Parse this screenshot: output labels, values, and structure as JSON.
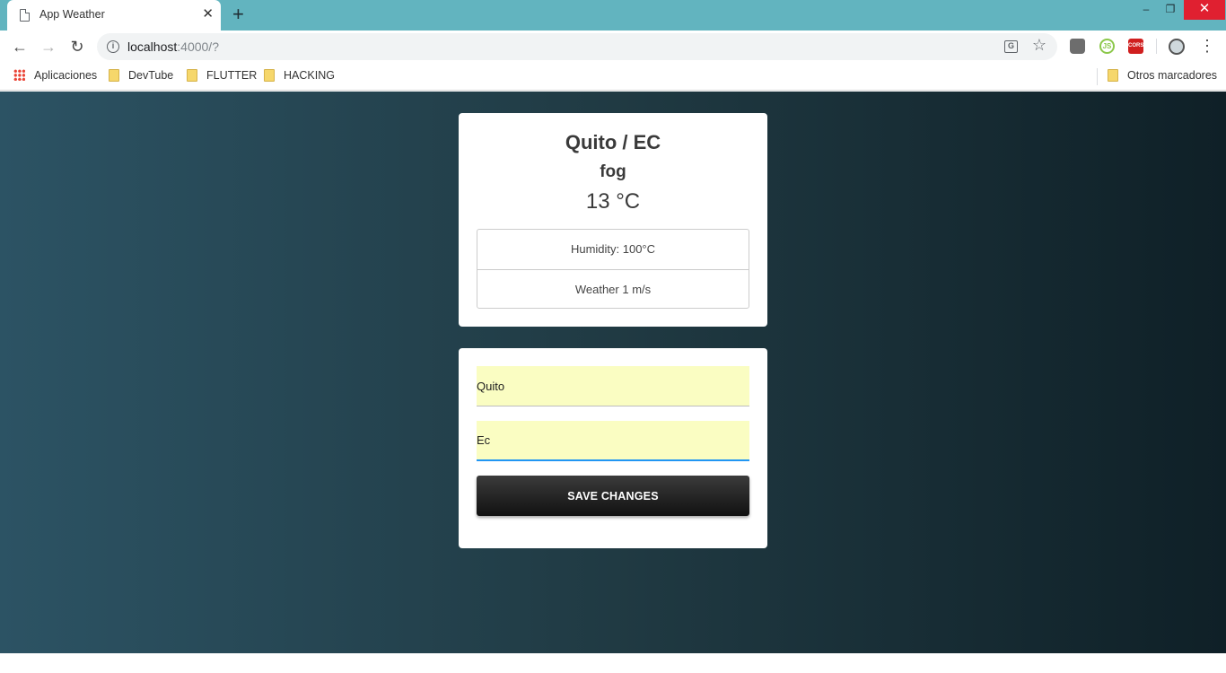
{
  "browser": {
    "tab_title": "App Weather",
    "tab_close": "✕",
    "new_tab": "+",
    "url_host": "localhost",
    "url_rest": ":4000/?",
    "window_controls": {
      "minimize": "–",
      "restore": "❐",
      "close": "✕"
    },
    "extensions": {
      "cors_label": "CORS",
      "node_label": "JS"
    }
  },
  "bookmarks": {
    "apps": "Aplicaciones",
    "items": [
      "DevTube",
      "FLUTTER",
      "HACKING"
    ],
    "other": "Otros marcadores"
  },
  "weather": {
    "location": "Quito / EC",
    "description": "fog",
    "temperature": "13 °C",
    "details": [
      "Humidity: 100°C",
      "Weather 1 m/s"
    ]
  },
  "form": {
    "city_value": "Quito",
    "country_value": "Ec",
    "save_label": "SAVE CHANGES"
  },
  "colors": {
    "titlebar": "#62b4bf",
    "gradient": [
      "#2c5364",
      "#203a43",
      "#0f2027"
    ],
    "input_bg": "#fafdc2",
    "focus_underline": "#2196f3"
  }
}
